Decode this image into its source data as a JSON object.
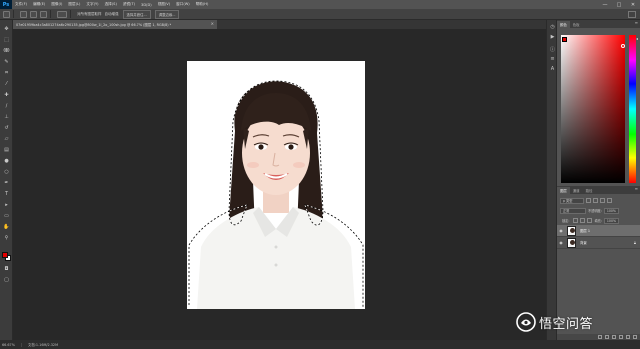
{
  "app": {
    "logo_text": "Ps",
    "menus": [
      "文件(F)",
      "编辑(E)",
      "图像(I)",
      "图层(L)",
      "文字(Y)",
      "选择(S)",
      "滤镜(T)",
      "3D(D)",
      "视图(V)",
      "窗口(W)",
      "帮助(H)"
    ],
    "window_controls": [
      "—",
      "□",
      "✕"
    ]
  },
  "options_bar": {
    "text": "自动增强",
    "refine_label": "调整边缘...",
    "sample_label": "对所有图层取样",
    "mask_label": "选择并遮住..."
  },
  "document": {
    "tab_title": "07e01959ba4c3a801274a6c290135.jpg@800w_1l_2o_100sh.jpg @ 66.7% (图层 1, RGB/8) *",
    "close_glyph": "×"
  },
  "status_bar": {
    "zoom": "66.67%",
    "doc_info": "文档:1.16M/2.32M"
  },
  "panels": {
    "color_tabs": [
      "颜色",
      "色板"
    ],
    "layer_tabs": [
      "图层",
      "通道",
      "路径"
    ],
    "filter_label": "p 类型",
    "blend_mode": "正常",
    "opacity_label": "不透明度:",
    "opacity_value": "100%",
    "lock_label": "锁定:",
    "fill_label": "填充:",
    "fill_value": "100%",
    "layers": [
      {
        "name": "图层 1",
        "selected": true
      },
      {
        "name": "背景",
        "selected": false
      }
    ]
  },
  "colors": {
    "foreground": "#e30000",
    "background": "#ffffff",
    "accent": "#31a8ff"
  },
  "icons": {
    "tools": [
      "move-icon",
      "marquee-icon",
      "lasso-icon",
      "quick-select-icon",
      "crop-icon",
      "eyedropper-icon",
      "healing-icon",
      "brush-icon",
      "stamp-icon",
      "history-brush-icon",
      "eraser-icon",
      "gradient-icon",
      "blur-icon",
      "dodge-icon",
      "pen-icon",
      "type-icon",
      "path-select-icon",
      "shape-icon",
      "hand-icon",
      "zoom-icon"
    ]
  },
  "watermark": {
    "text": "悟空问答"
  }
}
